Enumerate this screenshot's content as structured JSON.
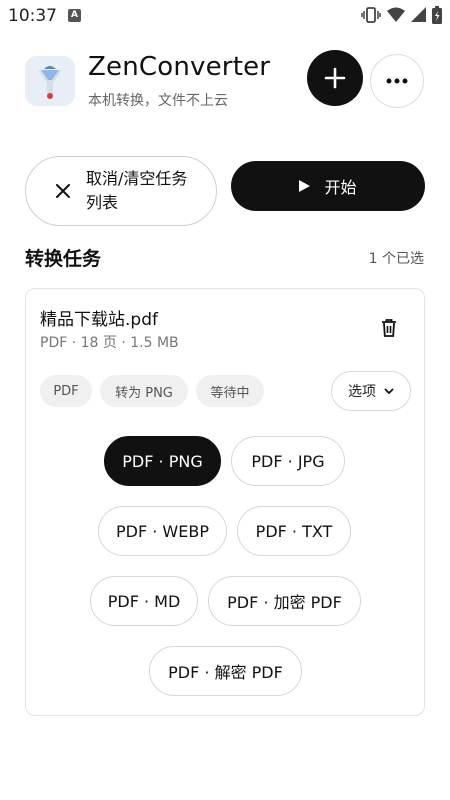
{
  "status_bar": {
    "time": "10:37",
    "notification_letter": "A"
  },
  "header": {
    "app_name": "ZenConverter",
    "tagline": "本机转换，文件不上云"
  },
  "actions": {
    "cancel_label": "取消/清空任务列表",
    "start_label": "开始"
  },
  "section": {
    "title": "转换任务",
    "selected_count": "1 个已选"
  },
  "task": {
    "file_name": "精品下载站.pdf",
    "file_meta": "PDF · 18 页 · 1.5 MB",
    "chips": {
      "format": "PDF",
      "target": "转为 PNG",
      "status": "等待中"
    },
    "options_label": "选项",
    "formats": [
      {
        "label": "PDF · PNG",
        "selected": true
      },
      {
        "label": "PDF · JPG",
        "selected": false
      },
      {
        "label": "PDF · WEBP",
        "selected": false
      },
      {
        "label": "PDF · TXT",
        "selected": false
      },
      {
        "label": "PDF · MD",
        "selected": false
      },
      {
        "label": "PDF · 加密 PDF",
        "selected": false
      },
      {
        "label": "PDF · 解密 PDF",
        "selected": false
      }
    ]
  },
  "colors": {
    "primary": "#111111",
    "chip_bg": "#f0f0f0",
    "border": "#d6d6d6"
  }
}
